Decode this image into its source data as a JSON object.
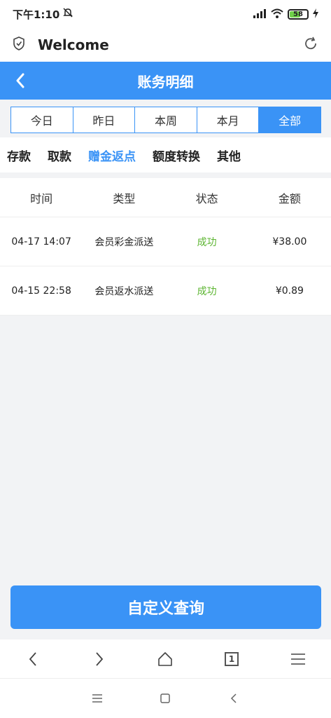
{
  "status_bar": {
    "time": "下午1:10",
    "battery": "58"
  },
  "browser": {
    "title": "Welcome"
  },
  "app": {
    "title": "账务明细"
  },
  "date_tabs": [
    {
      "label": "今日"
    },
    {
      "label": "昨日"
    },
    {
      "label": "本周"
    },
    {
      "label": "本月"
    },
    {
      "label": "全部",
      "active": true
    }
  ],
  "categories": [
    {
      "label": "存款"
    },
    {
      "label": "取款"
    },
    {
      "label": "赠金返点",
      "active": true
    },
    {
      "label": "额度转换"
    },
    {
      "label": "其他"
    }
  ],
  "table": {
    "headers": [
      "时间",
      "类型",
      "状态",
      "金额"
    ],
    "rows": [
      {
        "time": "04-17 14:07",
        "type": "会员彩金派送",
        "status": "成功",
        "amount": "¥38.00"
      },
      {
        "time": "04-15 22:58",
        "type": "会员返水派送",
        "status": "成功",
        "amount": "¥0.89"
      }
    ]
  },
  "query_button": "自定义查询",
  "toolbar": {
    "tab_count": "1"
  },
  "colors": {
    "accent": "#3a93f6",
    "success": "#5cb531"
  }
}
